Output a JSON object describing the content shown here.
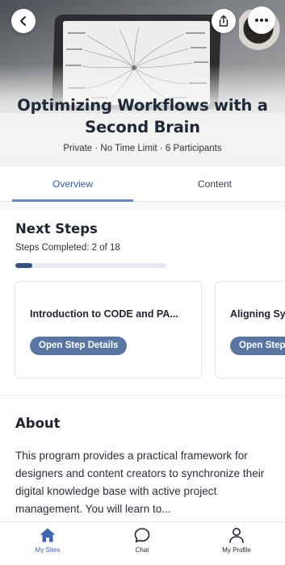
{
  "header": {
    "title": "Optimizing Workflows with a Second Brain",
    "meta": "Private · No Time Limit · 6 Participants"
  },
  "icons": {
    "back": "chevron-left-icon",
    "share": "share-icon",
    "more": "more-horizontal-icon",
    "my_sites": "home-icon",
    "chat": "chat-bubble-icon",
    "my_profile": "person-icon"
  },
  "tabs": [
    {
      "label": "Overview",
      "active": true
    },
    {
      "label": "Content",
      "active": false
    }
  ],
  "next_steps": {
    "title": "Next Steps",
    "completed_text": "Steps Completed: 2 of 18",
    "progress_fraction": 0.111,
    "cards": [
      {
        "title": "Introduction to CODE and PA...",
        "button": "Open Step Details"
      },
      {
        "title": "Aligning Sy",
        "button": "Open Step"
      }
    ]
  },
  "about": {
    "title": "About",
    "text": "This program provides a practical framework for designers and content creators to synchronize their digital knowledge base with active project management. You will learn to..."
  },
  "bottom_nav": [
    {
      "label": "My Sites",
      "active": true
    },
    {
      "label": "Chat",
      "active": false
    },
    {
      "label": "My Profile",
      "active": false
    }
  ],
  "colors": {
    "accent": "#3f66b0",
    "button": "#5876a1",
    "progress": "#33507d",
    "title": "#1e2a3a"
  }
}
